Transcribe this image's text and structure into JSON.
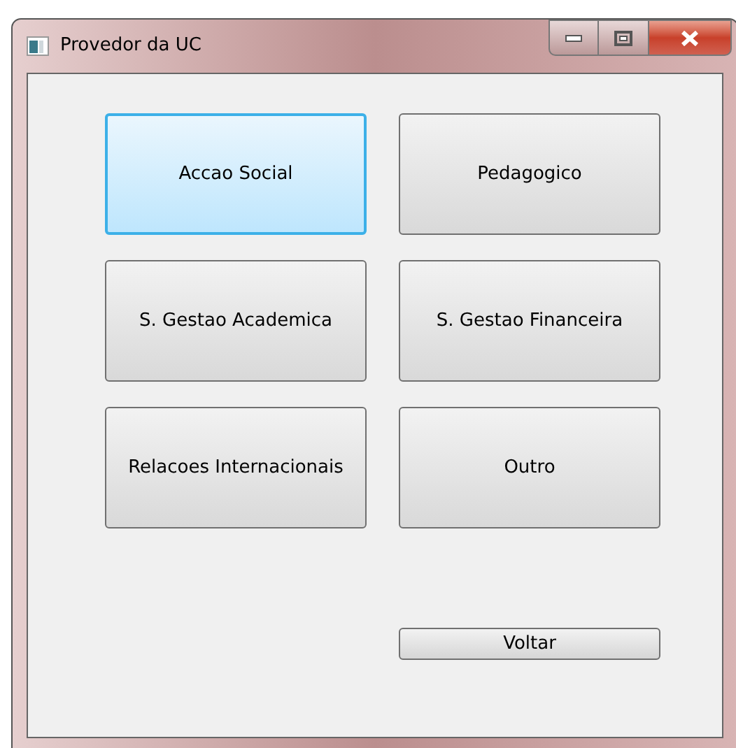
{
  "window": {
    "title": "Provedor da UC"
  },
  "buttons": [
    {
      "label": "Accao Social",
      "selected": true
    },
    {
      "label": "Pedagogico",
      "selected": false
    },
    {
      "label": "S. Gestao Academica",
      "selected": false
    },
    {
      "label": "S. Gestao Financeira",
      "selected": false
    },
    {
      "label": "Relacoes Internacionais",
      "selected": false
    },
    {
      "label": "Outro",
      "selected": false
    }
  ],
  "back_button": {
    "label": "Voltar"
  }
}
